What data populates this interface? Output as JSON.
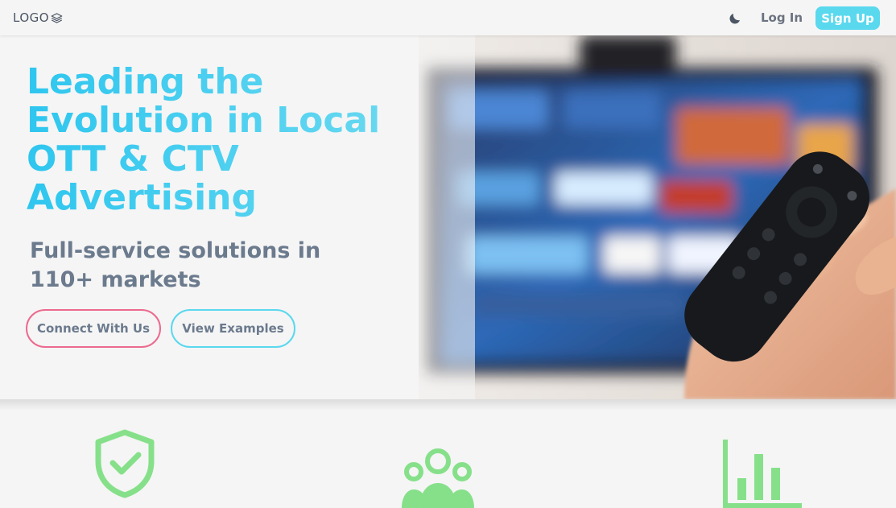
{
  "header": {
    "logo_text": "LOGO",
    "logo_icon": "layers-icon",
    "theme_toggle_icon": "moon-icon",
    "login_label": "Log In",
    "signup_label": "Sign Up"
  },
  "hero": {
    "title": "Leading the Evolution in Local OTT & CTV Advertising",
    "subtitle": "Full-service solutions in 110+ markets",
    "primary_button_label": "Connect With Us",
    "secondary_button_label": "View Examples",
    "image_icon": "tv-remote-photo"
  },
  "features": {
    "icons": [
      "shield-check-icon",
      "users-group-icon",
      "bar-chart-icon"
    ]
  },
  "colors": {
    "accent": "#5ad8ee",
    "accent_pink": "#ec6a8f",
    "feature_icon": "#86e08a",
    "text_muted": "#6b7a8d",
    "background": "#f5f5f5"
  }
}
